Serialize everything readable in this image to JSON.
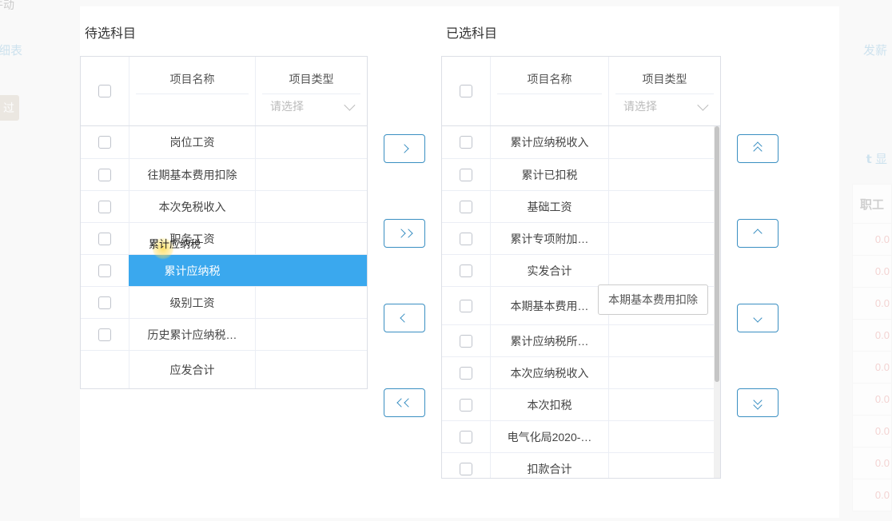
{
  "bg": {
    "top_fragment": "牛动",
    "link_table": "细表",
    "link_pay": "发薪",
    "pill": "过",
    "link_show": "𝘁 显",
    "col_header": "职工",
    "cells": [
      "0.0",
      "0.0",
      "0.0",
      "0.0",
      "0.0",
      "0.0",
      "0.0",
      "0.0",
      "0.0"
    ]
  },
  "left": {
    "title": "待选科目",
    "col_name": "项目名称",
    "col_type": "项目类型",
    "select_placeholder": "请选择",
    "rows": [
      {
        "name": "岗位工资"
      },
      {
        "name": "往期基本费用扣除"
      },
      {
        "name": "本次免税收入"
      },
      {
        "name": "职务工资"
      },
      {
        "name": "累计应纳税",
        "highlight": true
      },
      {
        "name": "级别工资"
      },
      {
        "name": "历史累计应纳税…"
      },
      {
        "name": "应发合计",
        "no_left_border": true
      }
    ],
    "cursor_hint": "累计应纳税"
  },
  "right": {
    "title": "已选科目",
    "col_name": "项目名称",
    "col_type": "项目类型",
    "select_placeholder": "请选择",
    "rows": [
      {
        "name": "累计应纳税收入"
      },
      {
        "name": "累计已扣税"
      },
      {
        "name": "基础工资"
      },
      {
        "name": "累计专项附加…"
      },
      {
        "name": "实发合计"
      },
      {
        "name": "本期基本费用…"
      },
      {
        "name": "累计应纳税所…"
      },
      {
        "name": "本次应纳税收入"
      },
      {
        "name": "本次扣税"
      },
      {
        "name": "电气化局2020-…"
      },
      {
        "name": "扣款合计"
      }
    ],
    "tooltip": "本期基本费用扣除"
  },
  "icons": {
    "move_right": "move-right",
    "move_all_right": "move-all-right",
    "move_left": "move-left",
    "move_all_left": "move-all-left",
    "move_top": "move-top",
    "move_up": "move-up",
    "move_down": "move-down",
    "move_bottom": "move-bottom"
  }
}
